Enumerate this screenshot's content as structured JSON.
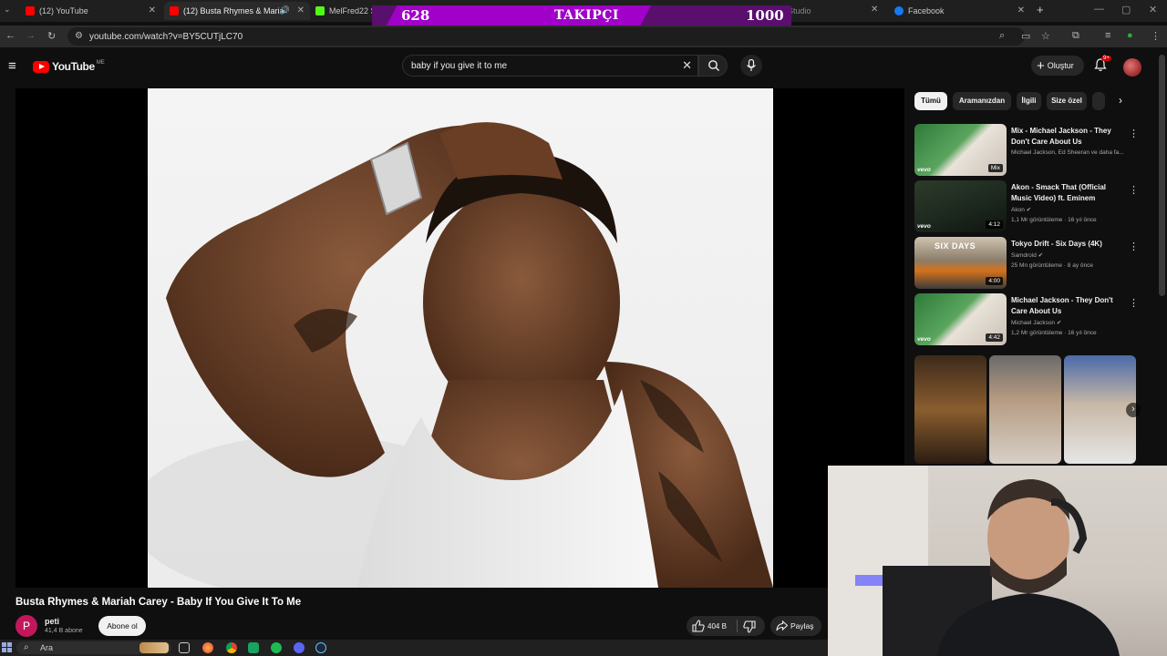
{
  "browser": {
    "tabs": [
      {
        "title": "(12) YouTube",
        "active": false,
        "favicon_color": "#ff0000"
      },
      {
        "title": "(12) Busta Rhymes & Maria",
        "active": true,
        "favicon_color": "#ff0000"
      },
      {
        "title": "MelFred22 Stream",
        "active": false,
        "favicon_color": "#53fc18"
      },
      {
        "title": "Studio",
        "active": false,
        "favicon_color": "#888888"
      },
      {
        "title": "Facebook",
        "active": false,
        "favicon_color": "#1877f2"
      }
    ],
    "url": "youtube.com/watch?v=BY5CUTjLC70"
  },
  "overlay": {
    "followers": "628",
    "label": "TAKIPÇI",
    "goal": "1000"
  },
  "youtube": {
    "logo_text": "YouTube",
    "logo_country": "ME",
    "search_query": "baby if you give it to me",
    "create_label": "Oluştur",
    "notification_count": "9+"
  },
  "video": {
    "title": "Busta Rhymes & Mariah Carey - Baby If You Give It To Me",
    "channel": {
      "avatar_letter": "P",
      "name": "peti",
      "subscribers": "41,4 B abone"
    },
    "subscribe_label": "Abone ol",
    "likes": "404 B",
    "share_label": "Paylaş"
  },
  "chips": [
    "Tümü",
    "Aramanızdan",
    "İlgili",
    "Size özel"
  ],
  "recommendations": [
    {
      "title": "Mix - Michael Jackson - They Don't Care About Us",
      "meta1": "Michael Jackson, Ed Sheeran ve daha fa...",
      "meta2": "",
      "badge": "Mix",
      "verified": false
    },
    {
      "title": "Akon - Smack That (Official Music Video) ft. Eminem",
      "meta1": "Akon",
      "meta2": "1,1 Mr görüntüleme · 16 yıl önce",
      "badge": "4:12",
      "verified": true
    },
    {
      "title": "Tokyo Drift - Six Days (4K)",
      "meta1": "Samdroid",
      "meta2": "25 Mn görüntüleme · 8 ay önce",
      "badge": "4:00",
      "verified": true
    },
    {
      "title": "Michael Jackson - They Don't Care About Us",
      "meta1": "Michael Jackson",
      "meta2": "1,2 Mr görüntüleme · 16 yıl önce",
      "badge": "4:42",
      "verified": true
    }
  ],
  "thumb_texts": {
    "vevo": "vevo",
    "six_days": "SIX DAYS"
  },
  "taskbar": {
    "search_label": "Ara"
  },
  "colors": {
    "yt_red": "#ff0000",
    "overlay_purple": "#a100c8",
    "bg": "#0f0f0f"
  }
}
